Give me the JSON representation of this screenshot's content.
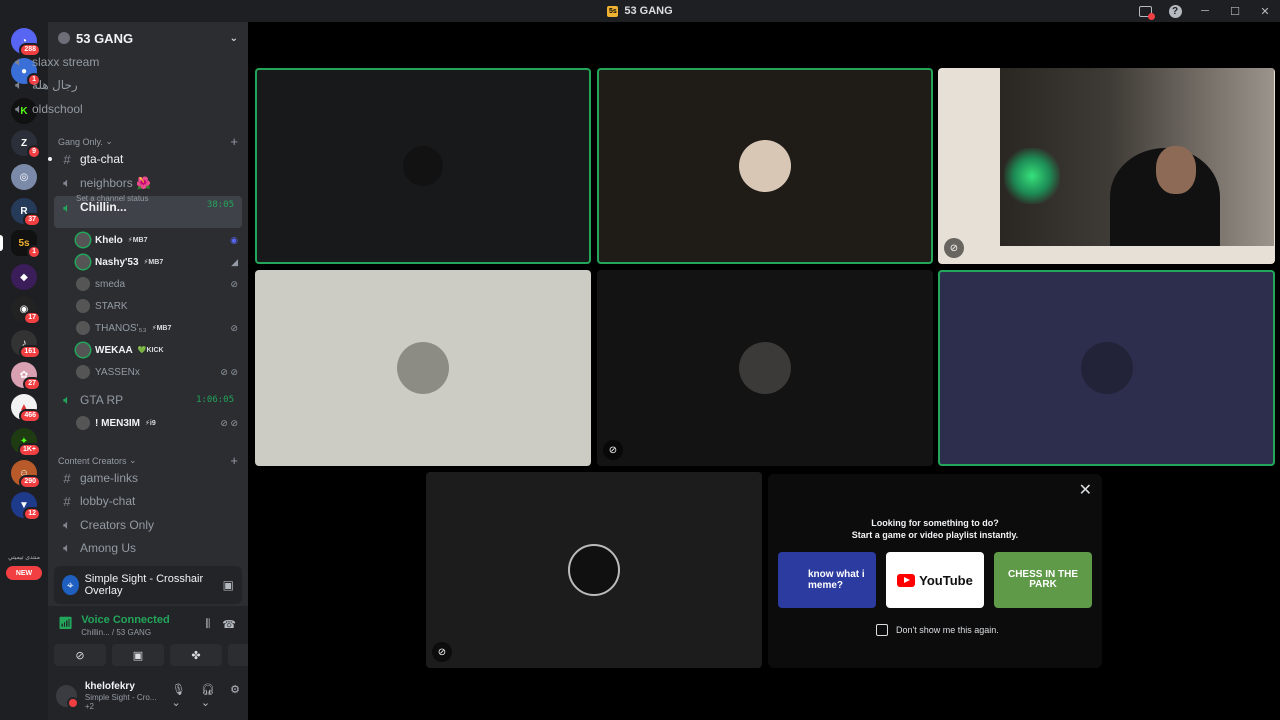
{
  "window": {
    "title": "53 GANG",
    "logo_text": "5s",
    "minimize": "─",
    "maximize": "☐",
    "close": "✕",
    "help": "?"
  },
  "rail": {
    "badges": [
      "288",
      "1",
      "",
      "9",
      "",
      "37",
      "1",
      "",
      "17",
      "161",
      "27",
      "466",
      "1K+",
      "290",
      "12"
    ],
    "community_label": "منتدى تيميتي",
    "new_label": "NEW"
  },
  "guild": {
    "name": "53 GANG"
  },
  "channels": {
    "top": [
      {
        "name": "slaxx stream"
      },
      {
        "name": "رجال هلة"
      },
      {
        "name": "oldschool"
      }
    ],
    "gang_category": "Gang Only.",
    "gang": [
      {
        "name": "gta-chat",
        "type": "text"
      },
      {
        "name": "neighbors 🌺",
        "type": "voice"
      },
      {
        "name": "Chillin...",
        "type": "voice",
        "timer": "38:05",
        "status": "Set a channel status"
      }
    ],
    "chillin_users": [
      {
        "name": "Khelo",
        "tag": "⚡MB7",
        "bright": true,
        "speaking": true
      },
      {
        "name": "Nashy'53",
        "tag": "⚡MB7",
        "bright": true,
        "speaking": true
      },
      {
        "name": "smeda",
        "tag": "",
        "bright": false,
        "speaking": false
      },
      {
        "name": "STARK",
        "tag": "",
        "bright": false,
        "speaking": false
      },
      {
        "name": "THANOS'₅₃",
        "tag": "⚡MB7",
        "bright": false,
        "speaking": false
      },
      {
        "name": "WEKAA",
        "tag": "💚KICK",
        "bright": true,
        "speaking": true
      },
      {
        "name": "YASSENx",
        "tag": "",
        "bright": false,
        "speaking": false
      }
    ],
    "gta_rp": {
      "name": "GTA RP",
      "timer": "1:06:05"
    },
    "gta_users": [
      {
        "name": "! MEN3IM",
        "tag": "⚡i9",
        "bright": true
      }
    ],
    "creators_category": "Content Creators",
    "creators": [
      {
        "name": "game-links",
        "type": "text"
      },
      {
        "name": "lobby-chat",
        "type": "text"
      },
      {
        "name": "Creators Only",
        "type": "voice"
      },
      {
        "name": "Among Us",
        "type": "voice"
      }
    ]
  },
  "activity": {
    "name": "Simple Sight - Crosshair Overlay"
  },
  "voice": {
    "status": "Voice Connected",
    "location": "Chillin... / 53 GANG"
  },
  "user": {
    "name": "khelofekry",
    "status": "Simple Sight - Cro...",
    "extra": "+2"
  },
  "suggestion": {
    "line1": "Looking for something to do?",
    "line2": "Start a game or video playlist instantly.",
    "activities": [
      {
        "name": "know what i meme?"
      },
      {
        "name": "YouTube"
      },
      {
        "name": "CHESS IN THE PARK"
      }
    ],
    "dont_show": "Don't show me this again."
  },
  "colors": {
    "speaking": "#23a55a",
    "badge": "#f23f42",
    "sidebar": "#2b2d31",
    "rail": "#1e1f22"
  }
}
